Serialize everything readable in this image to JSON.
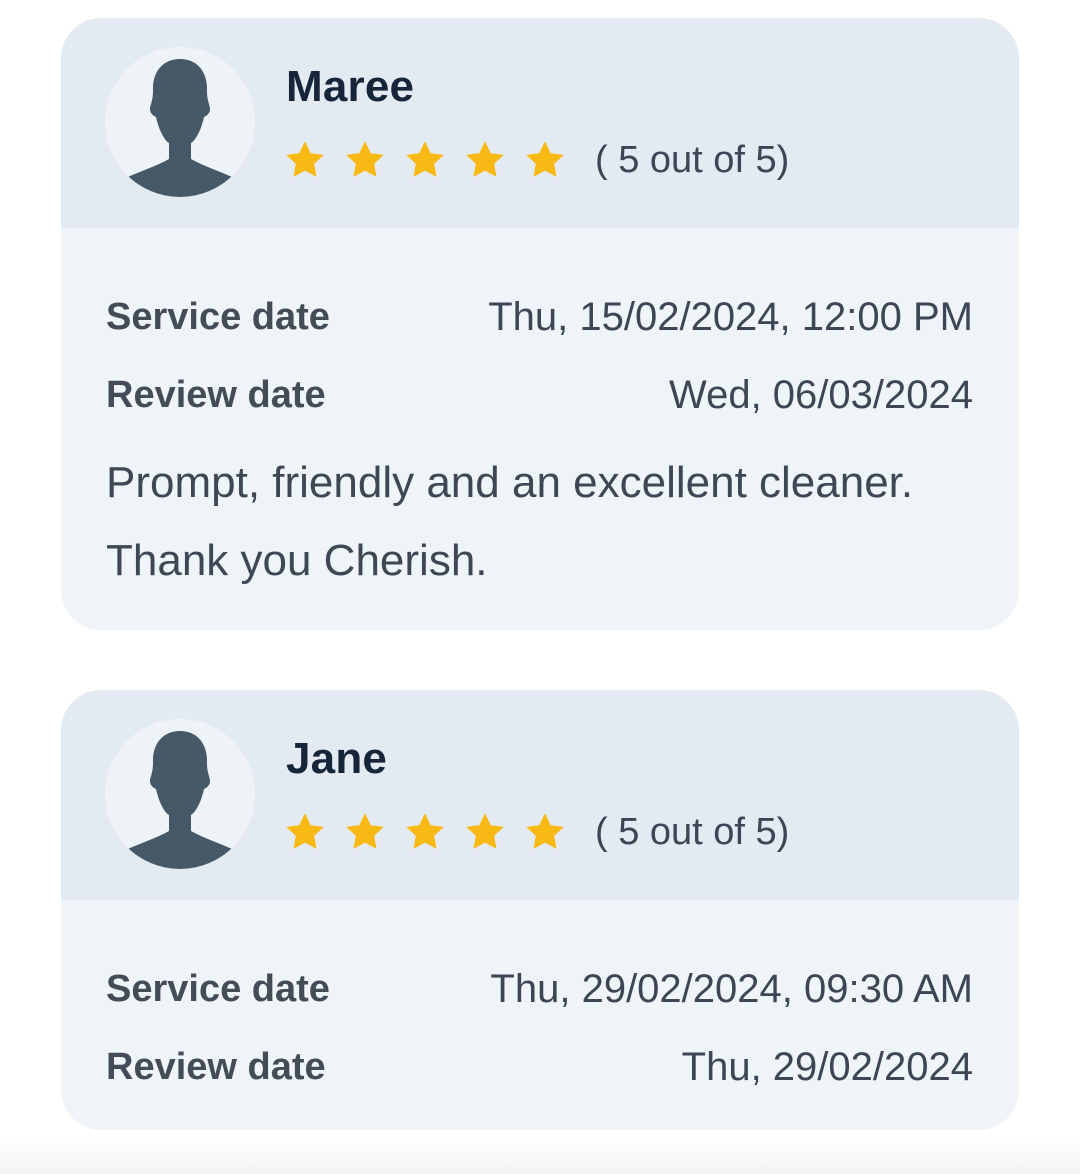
{
  "reviews": [
    {
      "name": "Maree",
      "rating": 5,
      "rating_max": 5,
      "rating_text": "( 5 out of 5)",
      "service_date_label": "Service date",
      "service_date": "Thu, 15/02/2024, 12:00 PM",
      "review_date_label": "Review date",
      "review_date": "Wed, 06/03/2024",
      "comment_line_1": "Prompt, friendly and an excellent cleaner.",
      "comment_line_2": "Thank you Cherish."
    },
    {
      "name": "Jane",
      "rating": 5,
      "rating_max": 5,
      "rating_text": "( 5 out of 5)",
      "service_date_label": "Service date",
      "service_date": "Thu, 29/02/2024, 09:30 AM",
      "review_date_label": "Review date",
      "review_date": "Thu, 29/02/2024"
    }
  ],
  "icons": {
    "avatar": "user-silhouette-icon",
    "star": "star-icon"
  },
  "colors": {
    "card_background": "#eff4f9",
    "card_header": "#e3eaf2",
    "star": "#f9b914",
    "avatar_silhouette": "#465968",
    "name_text": "#17253a"
  }
}
